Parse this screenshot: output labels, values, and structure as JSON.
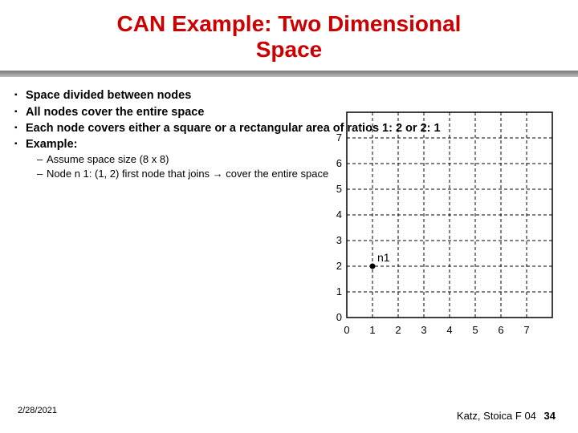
{
  "title_line1": "CAN Example: Two Dimensional",
  "title_line2": "Space",
  "bullets": {
    "b0": "Space divided between nodes",
    "b1": "All nodes cover the entire space",
    "b2": "Each node covers either a square or a rectangular area of ratios 1: 2 or 2: 1",
    "b3": "Example:"
  },
  "sub": {
    "s0": "Assume space size (8 x 8)",
    "s1_a": "Node n 1: (1, 2) first node that joins ",
    "s1_arrow": "→",
    "s1_b": " cover the entire space"
  },
  "chart_data": {
    "type": "scatter",
    "title": "",
    "xlabel": "",
    "ylabel": "",
    "xlim": [
      0,
      7
    ],
    "ylim": [
      0,
      7
    ],
    "xticks": [
      0,
      1,
      2,
      3,
      4,
      5,
      6,
      7
    ],
    "yticks": [
      0,
      1,
      2,
      3,
      4,
      5,
      6,
      7
    ],
    "grid": true,
    "series": [
      {
        "name": "n1",
        "x": [
          1
        ],
        "y": [
          2
        ],
        "label": "n1"
      }
    ]
  },
  "ticks": {
    "x0": "0",
    "x1": "1",
    "x2": "2",
    "x3": "3",
    "x4": "4",
    "x5": "5",
    "x6": "6",
    "x7": "7",
    "y0": "0",
    "y1": "1",
    "y2": "2",
    "y3": "3",
    "y4": "4",
    "y5": "5",
    "y6": "6",
    "y7": "7"
  },
  "node_label": "n1",
  "footer": {
    "date": "2/28/2021",
    "credit": "Katz, Stoica F 04",
    "page": "34"
  }
}
